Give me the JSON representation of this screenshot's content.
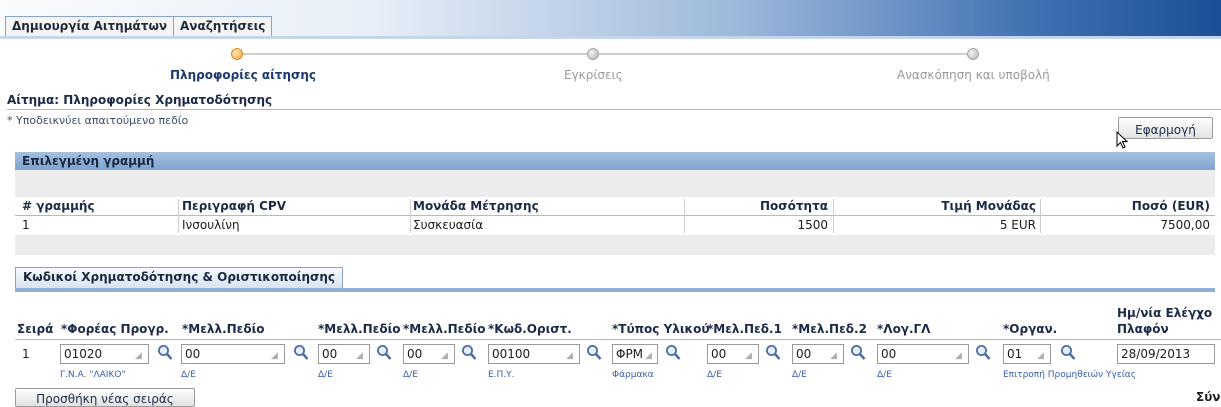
{
  "tabs": {
    "create": "Δημιουργία Αιτημάτων",
    "search": "Αναζητήσεις"
  },
  "train": {
    "step1": "Πληροφορίες αίτησης",
    "step2": "Εγκρίσεις",
    "step3": "Ανασκόπηση και υποβολή",
    "active_step": 1
  },
  "page": {
    "title": "Αίτημα: Πληροφορίες Χρηματοδότησης",
    "required_note": "* Υποδεικνύει απαιτούμενο πεδίο",
    "apply_button": "Εφαρμογή"
  },
  "selected_line": {
    "header": "Επιλεγμένη γραμμή",
    "columns": {
      "line_no": "# γραμμής",
      "cpv_desc": "Περιγραφή CPV",
      "unit": "Μονάδα Μέτρησης",
      "qty": "Ποσότητα",
      "unit_price": "Τιμή Μονάδας",
      "amount": "Ποσό (EUR)"
    },
    "row": {
      "line_no": "1",
      "cpv_desc": "Ινσουλίνη",
      "unit": "Συσκευασία",
      "qty": "1500",
      "unit_price": "5 EUR",
      "amount": "7500,00"
    }
  },
  "funding": {
    "tab": "Κωδικοί Χρηματοδότησης & Οριστικοποίησης",
    "columns": {
      "row": "Σειρά",
      "agency": "*Φορέας Προγρ.",
      "field1": "*Μελλ.Πεδίο",
      "field2": "*Μελλ.Πεδίο",
      "field3": "*Μελλ.Πεδίο",
      "code": "*Κωδ.Οριστ.",
      "material": "*Τύπος Υλικού",
      "f1": "*Μελ.Πεδ.1",
      "f2": "*Μελ.Πεδ.2",
      "gl": "*Λογ.ΓΛ",
      "org": "*Οργαν.",
      "date_line1": "Ημ/νία Ελέγχο",
      "date_line2": "Πλαφόν"
    },
    "row": {
      "row": "1",
      "agency": "01020",
      "field1": "00",
      "field2": "00",
      "field3": "00",
      "code": "00100",
      "material": "ΦΡΜ",
      "f1": "00",
      "f2": "00",
      "gl": "00",
      "org": "01",
      "date": "28/09/2013"
    },
    "desc": {
      "agency": "Γ.Ν.Α. \"ΛΑΙΚΟ\"",
      "field1": "Δ/Ε",
      "field2": "Δ/Ε",
      "field3": "Δ/Ε",
      "code": "Ε.Π.Υ.",
      "material": "Φάρμακα",
      "f1": "Δ/Ε",
      "f2": "Δ/Ε",
      "gl": "Δ/Ε",
      "org": "Επιτροπή Προμηθειών Υγείας"
    },
    "add_row": "Προσθήκη νέας σειράς",
    "total": "Σύν"
  },
  "icons": {
    "lookup": "magnifier-icon",
    "dropdown": "dropdown-marker-icon",
    "cursor": "mouse-cursor-icon"
  }
}
